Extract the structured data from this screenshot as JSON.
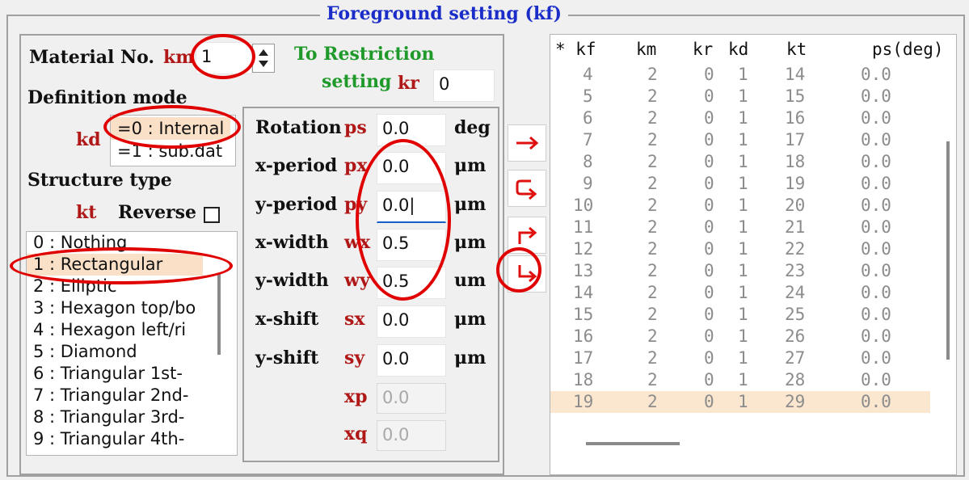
{
  "title": "Foreground setting (kf)",
  "material": {
    "label": "Material No.",
    "key": "km",
    "value": "1"
  },
  "restriction": {
    "line1": "To Restriction",
    "line2": "setting",
    "key": "kr",
    "value": "0"
  },
  "definition": {
    "label": "Definition mode",
    "key": "kd",
    "options": [
      "=0 : Internal",
      "=1 : sub.dat"
    ],
    "selected_index": 0
  },
  "structure": {
    "label": "Structure type",
    "key": "kt",
    "reverse_label": "Reverse",
    "items": [
      "0 : Nothing",
      "1 : Rectangular",
      "2 : Elliptic",
      "3 : Hexagon top/bo",
      "4 : Hexagon left/ri",
      "5 : Diamond",
      "6 : Triangular 1st-",
      "7 : Triangular 2nd-",
      "8 : Triangular 3rd-",
      "9 : Triangular 4th-"
    ],
    "selected_index": 1
  },
  "params": [
    {
      "name": "Rotation",
      "key": "ps",
      "value": "0.0",
      "unit": "deg"
    },
    {
      "name": "x-period",
      "key": "px",
      "value": "0.0",
      "unit": "μm"
    },
    {
      "name": "y-period",
      "key": "py",
      "value": "0.0|",
      "unit": "μm"
    },
    {
      "name": "x-width",
      "key": "wx",
      "value": "0.5",
      "unit": "μm"
    },
    {
      "name": "y-width",
      "key": "wy",
      "value": "0.5",
      "unit": "um"
    },
    {
      "name": "x-shift",
      "key": "sx",
      "value": "0.0",
      "unit": "μm"
    },
    {
      "name": "y-shift",
      "key": "sy",
      "value": "0.0",
      "unit": "μm"
    },
    {
      "name": "",
      "key": "xp",
      "value": "0.0",
      "unit": ""
    },
    {
      "name": "",
      "key": "xq",
      "value": "0.0",
      "unit": ""
    }
  ],
  "buttons": [
    {
      "icon": "arrow-right-icon",
      "color": "#e01010"
    },
    {
      "icon": "return-loop-icon",
      "color": "#e01010"
    },
    {
      "icon": "arrow-up-right-icon",
      "color": "#e01010"
    },
    {
      "icon": "arrow-down-right-icon",
      "color": "#e01010"
    }
  ],
  "table": {
    "headers": [
      "* kf",
      "km",
      "kr",
      "kd",
      "kt",
      "ps(deg)"
    ],
    "rows": [
      [
        "4",
        "2",
        "0",
        "1",
        "14",
        "0.0"
      ],
      [
        "5",
        "2",
        "0",
        "1",
        "15",
        "0.0"
      ],
      [
        "6",
        "2",
        "0",
        "1",
        "16",
        "0.0"
      ],
      [
        "7",
        "2",
        "0",
        "1",
        "17",
        "0.0"
      ],
      [
        "8",
        "2",
        "0",
        "1",
        "18",
        "0.0"
      ],
      [
        "9",
        "2",
        "0",
        "1",
        "19",
        "0.0"
      ],
      [
        "10",
        "2",
        "0",
        "1",
        "20",
        "0.0"
      ],
      [
        "11",
        "2",
        "0",
        "1",
        "21",
        "0.0"
      ],
      [
        "12",
        "2",
        "0",
        "1",
        "22",
        "0.0"
      ],
      [
        "13",
        "2",
        "0",
        "1",
        "23",
        "0.0"
      ],
      [
        "14",
        "2",
        "0",
        "1",
        "24",
        "0.0"
      ],
      [
        "15",
        "2",
        "0",
        "1",
        "25",
        "0.0"
      ],
      [
        "16",
        "2",
        "0",
        "1",
        "26",
        "0.0"
      ],
      [
        "17",
        "2",
        "0",
        "1",
        "27",
        "0.0"
      ],
      [
        "18",
        "2",
        "0",
        "1",
        "28",
        "0.0"
      ],
      [
        "19",
        "2",
        "0",
        "1",
        "29",
        "0.0"
      ]
    ],
    "selected_row": 15
  },
  "colors": {
    "title": "#1a2dc8",
    "param_key": "#b01818",
    "restriction_text": "#1f9a2a",
    "selection": "#fbe0c8",
    "annotation": "#e00000"
  }
}
